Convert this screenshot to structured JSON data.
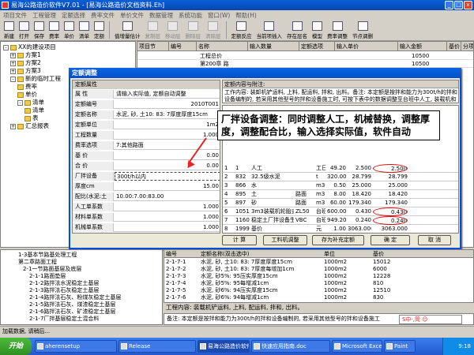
{
  "window": {
    "title": "易海公路造价软件V7.01 - [易海公路造价文档资料.Eh]"
  },
  "menu": [
    "项目文件",
    "工程管理",
    "定额选择",
    "费率文件",
    "单价文件",
    "数据管理",
    "系统功能",
    "窗口(W)",
    "帮助(H)"
  ],
  "toolbar": [
    "新建",
    "打开",
    "保存",
    "费率",
    "单价",
    "清单",
    "定额",
    "",
    "值增量估计",
    "复制层",
    "移动层",
    "删除层",
    "清除层",
    "",
    "定额反应",
    "当前项插入",
    "存在层名",
    "模型",
    "费率调整",
    "节点调删"
  ],
  "tree": {
    "items": [
      {
        "label": "XX的建设项目",
        "indent": 0,
        "box": "-"
      },
      {
        "label": "方案1",
        "indent": 1,
        "box": "+"
      },
      {
        "label": "方案2",
        "indent": 1,
        "box": "+"
      },
      {
        "label": "方案3",
        "indent": 1,
        "box": "+"
      },
      {
        "label": "新的临时工程",
        "indent": 1,
        "box": "-"
      },
      {
        "label": "费率",
        "indent": 2,
        "box": ""
      },
      {
        "label": "单价",
        "indent": 2,
        "box": ""
      },
      {
        "label": "清单",
        "indent": 2,
        "box": "-"
      },
      {
        "label": "清单",
        "indent": 3,
        "box": ""
      },
      {
        "label": "表",
        "indent": 3,
        "box": ""
      },
      {
        "label": "汇总报表",
        "indent": 1,
        "box": "+"
      }
    ]
  },
  "main_grid": {
    "headers": [
      "项目节",
      "编号",
      "名称",
      "输入数量",
      "定额选项",
      "输入单价",
      "输入金额",
      "基价",
      "分项单价"
    ],
    "rows": [
      {
        "no": "",
        "code": "",
        "name": "工程总价",
        "amount": "10500"
      },
      {
        "no": "",
        "code": "",
        "name": "第200章 路",
        "amount": "10500"
      }
    ]
  },
  "dialog": {
    "title": "定额调整",
    "section_label": "定额属性",
    "props": [
      {
        "label": "属  性",
        "value": "请输入实际值, 定额自动调整"
      },
      {
        "label": "定额编号",
        "value": "2010T001"
      },
      {
        "label": "定额名称",
        "value": "水泥, 砂, 土10: 83: 7厚度厚度15cm"
      },
      {
        "label": "定额单位",
        "value": "1m2"
      },
      {
        "label": "工程数量",
        "value": "1.000"
      },
      {
        "label": "费率选项",
        "value": "7:其他路面"
      },
      {
        "label": "基  价",
        "value": "0.00"
      },
      {
        "label": "合  价",
        "value": "0.00"
      },
      {
        "label": "厂拌设备",
        "value": "300t/h以内"
      },
      {
        "label": "厚度cm",
        "value": "15.00"
      },
      {
        "label": "配比(水泥:土",
        "value": "10.00:7.00:83.00"
      },
      {
        "label": "人工单系数",
        "value": "1.000"
      },
      {
        "label": "材料单系数",
        "value": "1.000"
      },
      {
        "label": "机械单系数",
        "value": "1.000"
      }
    ],
    "content_head": "定额内容与附注:",
    "content_text": "工作内容: 装卸机铲运料, 上料, 配运料, 拌和, 出料。备注: 本定额是按拌和能力为300t/h的拌和设备编制的, 若采用其他型号的拌和设备施工时, 可按下表中的数据调整至台班中人工, 装载机和拌和设备的消耗数量。",
    "res_rows": [
      {
        "seq": "1",
        "code": "1",
        "name": "人工",
        "spec": "",
        "unit": "工日",
        "price": "49.20",
        "qty": "2.500",
        "dqty": "2.500"
      },
      {
        "seq": "2",
        "code": "832",
        "name": "32.5级水泥",
        "spec": "",
        "unit": "t",
        "price": "320.00",
        "qty": "28.799",
        "dqty": "28.799"
      },
      {
        "seq": "3",
        "code": "866",
        "name": "水",
        "spec": "",
        "unit": "m3",
        "price": "0.50",
        "qty": "25.000",
        "dqty": "25.000"
      },
      {
        "seq": "4",
        "code": "895",
        "name": "土",
        "spec": "路面",
        "unit": "m3",
        "price": "8.00",
        "qty": "18.420",
        "dqty": "18.420"
      },
      {
        "seq": "5",
        "code": "897",
        "name": "砂",
        "spec": "路面",
        "unit": "m3",
        "price": "60.00",
        "qty": "179.340",
        "dqty": "179.340"
      },
      {
        "seq": "6",
        "code": "1051",
        "name": "3m3装载机轮胎式",
        "spec": "ZL50",
        "unit": "台班",
        "price": "600.00",
        "qty": "0.430",
        "dqty": "0.430"
      },
      {
        "seq": "7",
        "code": "1160",
        "name": "稳定土厂拌设备生产",
        "spec": "VBC",
        "unit": "台班",
        "price": "949.20",
        "qty": "0.240",
        "dqty": "0.240"
      },
      {
        "seq": "8",
        "code": "1999",
        "name": "基价",
        "spec": "",
        "unit": "元",
        "price": "1.00",
        "qty": "3063.000",
        "dqty": "3063.000"
      }
    ],
    "buttons": [
      "计  算",
      "工料机调整",
      "存为补充定额",
      "确  定",
      "取  消"
    ]
  },
  "annotation": "厂拌设备调整：同时调整人工，机械替换，调整厚度，调整配合比，输入选择实际值，软件自动",
  "tree2": [
    "1-3基本节路基处理工程",
    "第二章路面工程",
    "2-1一节路面基层及底层",
    "2-1-1路面垫层",
    "2-1-2路拌法水泥稳定土基层",
    "2-1-3路拌法石灰稳定土基层",
    "2-1-4路拌法石灰、粉煤灰稳定土基层",
    "2-1-5路拌法石灰、煤渣稳定土基层",
    "2-1-6路拌法石灰、矿渣稳定土基层",
    "2-1-7厂拌基层稳定土混合料"
  ],
  "libgrid": {
    "headers": [
      "编号",
      "定额名称(双击选中)",
      "单位",
      "基价"
    ],
    "rows": [
      {
        "code": "2-1-7-1",
        "name": "水泥, 砂, 土10: 83: 7厚度厚度15cm",
        "unit": "1000m2",
        "price": "15012"
      },
      {
        "code": "2-1-7-2",
        "name": "水泥, 砂, 土10: 83: 7厚度每增加1cm",
        "unit": "1000m2",
        "price": "6000"
      },
      {
        "code": "2-1-7-3",
        "name": "水泥, 砂5%: 95压实厚度15cm",
        "unit": "1000m2",
        "price": "12228"
      },
      {
        "code": "2-1-7-4",
        "name": "水泥, 砂5%: 95每增减1cm",
        "unit": "1000m2",
        "price": "810"
      },
      {
        "code": "2-1-7-5",
        "name": "水泥, 砂6%: 94压实厚度15cm",
        "unit": "1000m2",
        "price": "12510"
      },
      {
        "code": "2-1-7-6",
        "name": "水泥, 砂6%: 94每增减1cm",
        "unit": "1000m2",
        "price": "830"
      }
    ]
  },
  "work_info": "工程内容:  装载机铲运料, 上料, 配运料, 拌和, 出料。",
  "note": "备注: 本定额是按拌和能力为300t/h的拌和设备编制的, 若采用其他型号的拌和设备施工",
  "status": "加载数据, 请稍后...",
  "taskbar": {
    "start": "开始",
    "tasks": [
      "aherensetup",
      "Release",
      "易海公路造价软件...",
      "快速应用指南.doc",
      "Microsoft Excel",
      "Paint"
    ],
    "clock": "9:18"
  },
  "ime": "S中·,简 ☺"
}
